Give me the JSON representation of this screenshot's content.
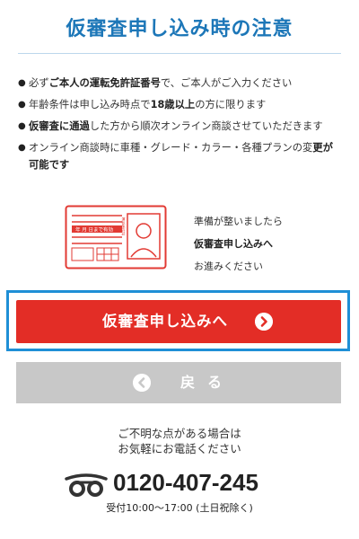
{
  "page": {
    "title": "仮審査申し込み時の注意"
  },
  "notes": [
    {
      "parts": [
        {
          "t": "必ず",
          "b": false
        },
        {
          "t": "ご本人の運転免許証番号",
          "b": true
        },
        {
          "t": "で、ご本人がご入力ください",
          "b": false
        }
      ]
    },
    {
      "parts": [
        {
          "t": "年齢条件は申し込み時点で",
          "b": false
        },
        {
          "t": "18歳以上",
          "b": true
        },
        {
          "t": "の方に限ります",
          "b": false
        }
      ]
    },
    {
      "parts": [
        {
          "t": "仮審査に通過",
          "b": true
        },
        {
          "t": "した方から順次オンライン商談させていただきます",
          "b": false
        }
      ]
    },
    {
      "parts": [
        {
          "t": "オンライン商談時に車種・グレード・カラー・各種プランの変",
          "b": false
        },
        {
          "t": "更が可能です",
          "b": true
        }
      ]
    }
  ],
  "license_card": {
    "label_date": "年 月 日まで有効",
    "label_side": "運転免許証"
  },
  "prompt": {
    "line1": "準備が整いましたら",
    "line2": "仮審査申し込みへ",
    "line3": "お進みください"
  },
  "buttons": {
    "apply": "仮審査申し込みへ",
    "back": "戻る"
  },
  "contact": {
    "line1": "ご不明な点がある場合は",
    "line2": "お気軽にお電話ください",
    "phone": "0120-407-245",
    "hours": "受付10:00〜17:00 (土日祝除く)"
  },
  "colors": {
    "title": "#1d77b8",
    "apply_button": "#e32d26",
    "focus_frame": "#1f8fd6",
    "back_button": "#c8c8c8"
  },
  "icons": {
    "apply": "chevron-right-circle-icon",
    "back": "chevron-left-circle-icon",
    "phone": "free-dial-icon",
    "license": "drivers-license-icon"
  }
}
